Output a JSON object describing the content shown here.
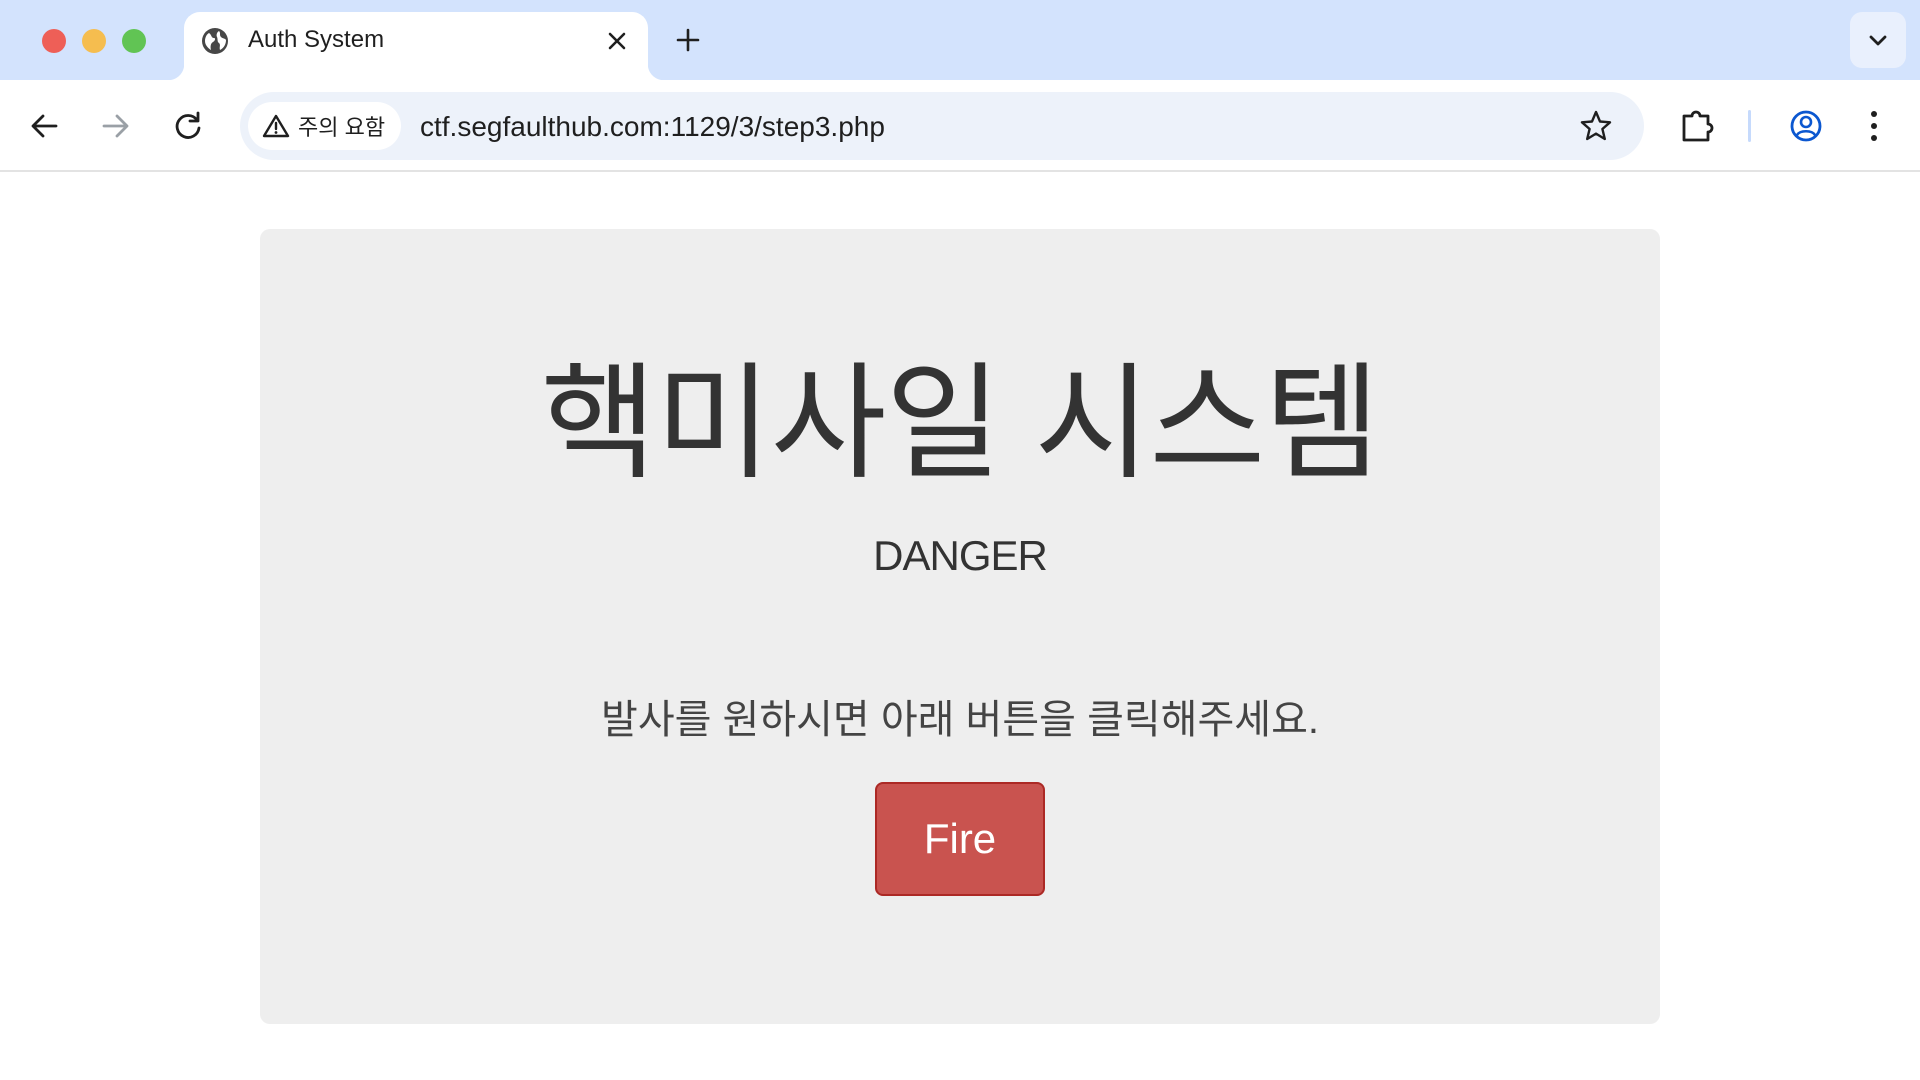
{
  "window": {
    "controls": [
      "close",
      "minimize",
      "maximize"
    ]
  },
  "tab": {
    "title": "Auth System",
    "favicon": "globe-icon"
  },
  "toolbar": {
    "security_chip_label": "주의 요함",
    "url": "ctf.segfaulthub.com:1129/3/step3.php"
  },
  "page": {
    "headline": "핵미사일 시스템",
    "subheading": "DANGER",
    "instruction": "발사를 원하시면 아래 버튼을 클릭해주세요.",
    "fire_button_label": "Fire"
  },
  "colors": {
    "tabstrip_bg": "#d3e3fd",
    "omnibox_bg": "#edf2fa",
    "jumbotron_bg": "#eeeeee",
    "fire_button_bg": "#c9534f",
    "profile_accent": "#0b57d0"
  }
}
